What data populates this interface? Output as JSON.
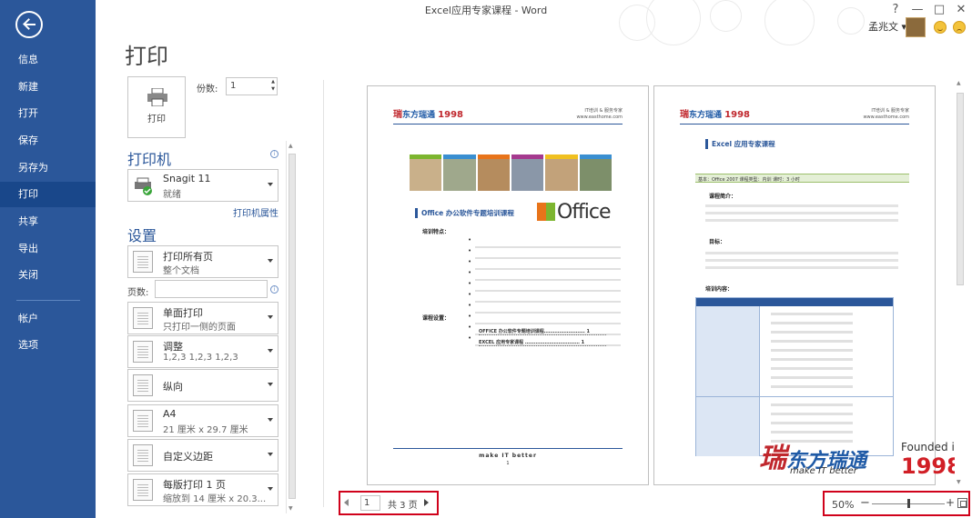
{
  "window": {
    "title": "Excel应用专家课程 - Word",
    "user": "孟兆文",
    "controls": [
      "?",
      "—",
      "□",
      "✕"
    ]
  },
  "nav": {
    "items": [
      "信息",
      "新建",
      "打开",
      "保存",
      "另存为",
      "打印",
      "共享",
      "导出",
      "关闭",
      "帐户",
      "选项"
    ],
    "active": "打印"
  },
  "print": {
    "title": "打印",
    "button_label": "打印",
    "copies_label": "份数:",
    "copies_value": "1",
    "printer_section": "打印机",
    "printer_name": "Snagit 11",
    "printer_status": "就绪",
    "printer_properties": "打印机属性",
    "settings_section": "设置",
    "pages_label": "页数:",
    "pages_value": "",
    "options": [
      {
        "main": "打印所有页",
        "sub": "整个文档"
      },
      {
        "main": "单面打印",
        "sub": "只打印一侧的页面"
      },
      {
        "main": "调整",
        "sub": "1,2,3    1,2,3    1,2,3"
      },
      {
        "main": "纵向",
        "sub": ""
      },
      {
        "main": "A4",
        "sub": "21 厘米 x 29.7 厘米"
      },
      {
        "main": "自定义边距",
        "sub": ""
      },
      {
        "main": "每版打印 1 页",
        "sub": "缩放到 14 厘米 x 20.3..."
      }
    ]
  },
  "preview": {
    "page1": {
      "logo_cn": "东方瑞通",
      "logo_year": "1998",
      "tagline": "IT培训 & 服务专家",
      "url": "www.easthome.com",
      "heading": "Office 办公软件专题培训课程",
      "office_logo": "Office",
      "features_label": "培训特点：",
      "schedule_label": "课程设置：",
      "toc": [
        "OFFICE 办公软件专题培训课程……………………… 1",
        "EXCEL 应用专家课程 ……………………………… 1"
      ],
      "footer": "make IT better",
      "page_number": "1"
    },
    "page2": {
      "heading": "Excel 应用专家课程",
      "info": "基本：Office 2007      课程类型：内训      课时：3 小时",
      "intro_label": "课程简介：",
      "goal_label": "目标：",
      "content_label": "培训内容："
    },
    "watermark": {
      "brand_cn": "东方瑞通",
      "slogan": "make IT better",
      "founded": "Founded in",
      "year": "1998"
    }
  },
  "pager": {
    "current": "1",
    "total": "共 3 页"
  },
  "zoom": {
    "level": "50%",
    "fraction": 0.5
  }
}
